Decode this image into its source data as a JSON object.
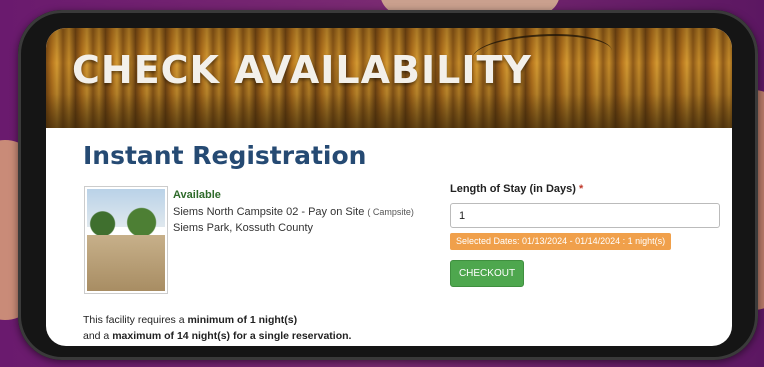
{
  "banner": {
    "title": "CHECK AVAILABILITY"
  },
  "page": {
    "heading": "Instant Registration"
  },
  "facility": {
    "status": "Available",
    "site_name": "Siems North Campsite 02 - Pay on Site",
    "site_type": "( Campsite)",
    "park": "Siems Park, Kossuth County",
    "image_icon": "campsite-photo"
  },
  "requirements": {
    "line1_prefix": "This facility requires a ",
    "line1_bold": "minimum of 1 night(s)",
    "line2_prefix": "and a ",
    "line2_bold": "maximum of 14 night(s)",
    "line2_suffix": " for a single reservation."
  },
  "form": {
    "stay_label": "Length of Stay (in Days)",
    "required_mark": "*",
    "stay_value": "1",
    "selected_dates": "Selected Dates: 01/13/2024 - 01/14/2024 : 1 night(s)",
    "checkout_label": "CHECKOUT"
  },
  "colors": {
    "heading": "#254a73",
    "available": "#2e6a2a",
    "dates_badge": "#f0a04b",
    "checkout": "#4ea74e",
    "required": "#c0392b"
  }
}
